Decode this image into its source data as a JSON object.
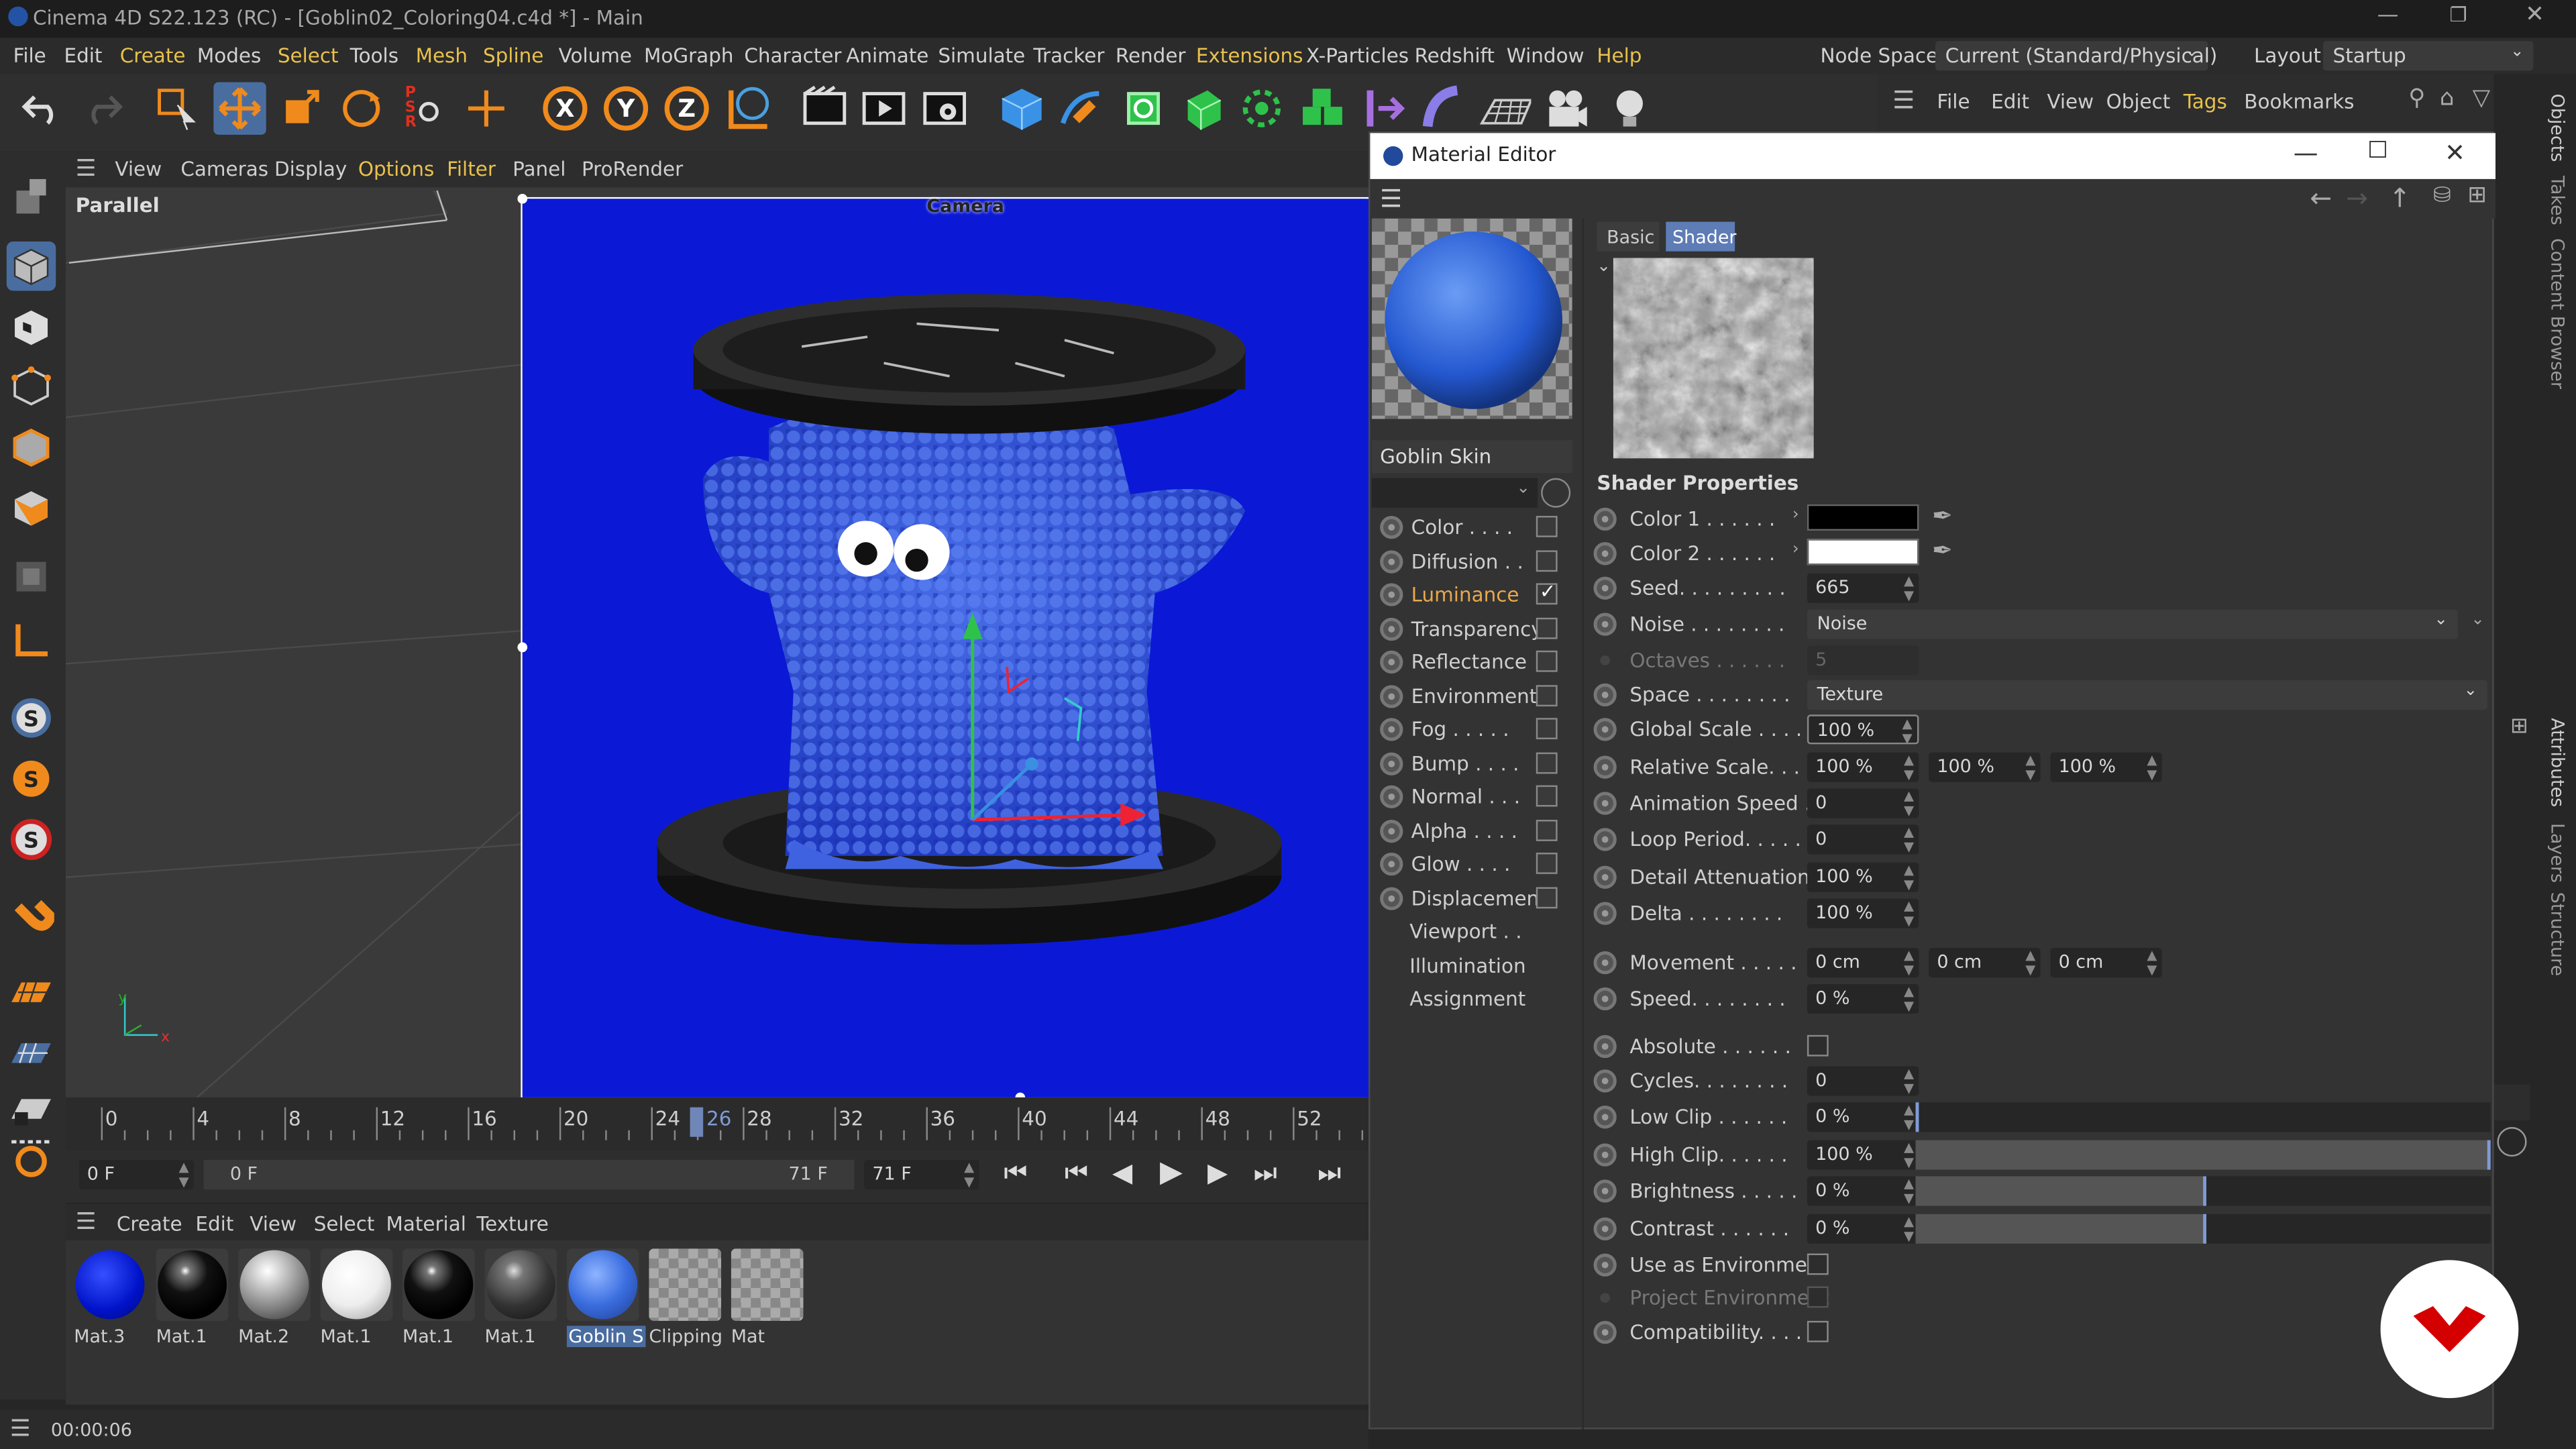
{
  "app": {
    "title": "Cinema 4D S22.123 (RC) - [Goblin02_Coloring04.c4d *] - Main",
    "menu": [
      "File",
      "Edit",
      "Create",
      "Modes",
      "Select",
      "Tools",
      "Mesh",
      "Spline",
      "Volume",
      "MoGraph",
      "Character",
      "Animate",
      "Simulate",
      "Tracker",
      "Render",
      "Extensions",
      "X-Particles",
      "Redshift",
      "Window",
      "Help"
    ],
    "node_space_label": "Node Space:",
    "node_space_value": "Current (Standard/Physical)",
    "layout_label": "Layout:",
    "layout_value": "Startup"
  },
  "viewport": {
    "menu": [
      "View",
      "Cameras",
      "Display",
      "Options",
      "Filter",
      "Panel",
      "ProRender"
    ],
    "projection": "Parallel",
    "camera_label": "Camera",
    "background_color": "#0b19d6"
  },
  "timeline": {
    "ticks": [
      "0",
      "4",
      "8",
      "12",
      "16",
      "20",
      "24",
      "28",
      "32",
      "36",
      "40",
      "44",
      "48",
      "52"
    ],
    "current_frame": "26",
    "start_field": "0 F",
    "range_start": "0 F",
    "range_end": "71 F",
    "end_field": "71 F"
  },
  "material_manager": {
    "menu": [
      "Create",
      "Edit",
      "View",
      "Select",
      "Material",
      "Texture"
    ],
    "materials": [
      {
        "label": "Mat.3",
        "kind": "blue"
      },
      {
        "label": "Mat.1",
        "kind": "black"
      },
      {
        "label": "Mat.2",
        "kind": "grey"
      },
      {
        "label": "Mat.1",
        "kind": "white"
      },
      {
        "label": "Mat.1",
        "kind": "black"
      },
      {
        "label": "Mat.1",
        "kind": "darkgrey"
      },
      {
        "label": "Goblin S",
        "kind": "goblin"
      },
      {
        "label": "Clipping",
        "kind": "checker"
      },
      {
        "label": "Mat",
        "kind": "checker"
      }
    ]
  },
  "status": {
    "time": "00:00:06"
  },
  "object_manager": {
    "menu": [
      "File",
      "Edit",
      "View",
      "Object",
      "Tags",
      "Bookmarks"
    ]
  },
  "side_tabs": [
    "Objects",
    "Takes",
    "Content Browser",
    "Attributes",
    "Layers",
    "Structure"
  ],
  "material_editor": {
    "title": "Material Editor",
    "material_name": "Goblin Skin",
    "tabs": [
      "Basic",
      "Shader"
    ],
    "channels": [
      {
        "label": "Color . . . .",
        "checked": false
      },
      {
        "label": "Diffusion . .",
        "checked": false
      },
      {
        "label": "Luminance",
        "checked": true,
        "active": true
      },
      {
        "label": "Transparency",
        "checked": false
      },
      {
        "label": "Reflectance",
        "checked": false
      },
      {
        "label": "Environment",
        "checked": false
      },
      {
        "label": "Fog . . . . .",
        "checked": false
      },
      {
        "label": "Bump . . . .",
        "checked": false
      },
      {
        "label": "Normal . . .",
        "checked": false
      },
      {
        "label": "Alpha . . . .",
        "checked": false
      },
      {
        "label": "Glow . . . .",
        "checked": false
      },
      {
        "label": "Displacement",
        "checked": false
      }
    ],
    "extra": [
      "Viewport . .",
      "Illumination",
      "Assignment"
    ],
    "section_title": "Shader Properties",
    "props": {
      "color1": "Color 1 . . . . . .",
      "color1_value": "#000000",
      "color2": "Color 2 . . . . . .",
      "color2_value": "#ffffff",
      "seed": "Seed. . . . . . . . .",
      "seed_val": "665",
      "noise": "Noise . . . . . . . .",
      "noise_val": "Noise",
      "octaves": "Octaves . . . . . .",
      "octaves_val": "5",
      "space": "Space . . . . . . . .",
      "space_val": "Texture",
      "global_scale": "Global Scale . . . .",
      "global_scale_val": "100 %",
      "relative_scale": "Relative Scale. . .",
      "relative_scale_vals": [
        "100 %",
        "100 %",
        "100 %"
      ],
      "anim_speed": "Animation Speed . .",
      "anim_speed_val": "0",
      "loop_period": "Loop Period. . . . .",
      "loop_period_val": "0",
      "detail_att": "Detail Attenuation",
      "detail_att_val": "100 %",
      "delta": "Delta . . . . . . . .",
      "delta_val": "100 %",
      "movement": "Movement . . . . .",
      "movement_vals": [
        "0 cm",
        "0 cm",
        "0 cm"
      ],
      "speed": "Speed. . . . . . . .",
      "speed_val": "0 %",
      "absolute": "Absolute . . . . . .",
      "cycles": "Cycles. . . . . . . .",
      "cycles_val": "0",
      "low_clip": "Low Clip . . . . . .",
      "low_clip_val": "0 %",
      "low_clip_frac": 0,
      "high_clip": "High Clip. . . . . .",
      "high_clip_val": "100 %",
      "high_clip_frac": 1,
      "brightness": "Brightness . . . . .",
      "brightness_val": "0 %",
      "brightness_frac": 0.5,
      "contrast": "Contrast . . . . . .",
      "contrast_val": "0 %",
      "contrast_frac": 0.5,
      "use_env": "Use as Environment",
      "proj_env": "Project Environment",
      "compat": "Compatibility. . . ."
    }
  }
}
